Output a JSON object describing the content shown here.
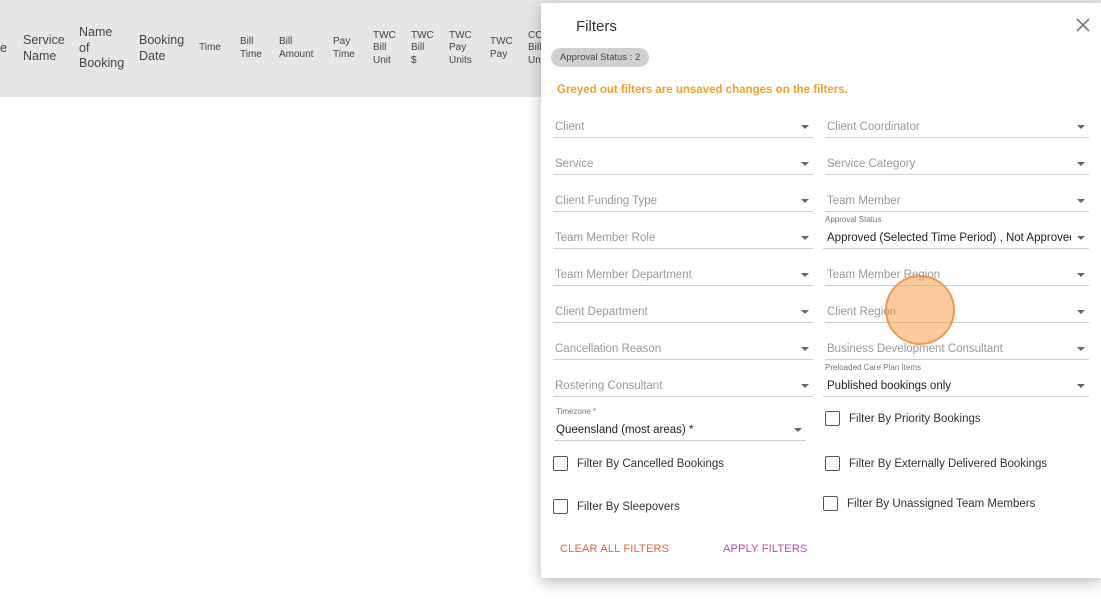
{
  "table_header": {
    "columns": [
      {
        "label": "e",
        "size": "lg"
      },
      {
        "label": "Service\nName",
        "size": "lg"
      },
      {
        "label": "Name\nof\nBooking",
        "size": "lg"
      },
      {
        "label": "Booking\nDate",
        "size": "lg"
      },
      {
        "label": "Time",
        "size": "sm"
      },
      {
        "label": "Bill\nTime",
        "size": "sm"
      },
      {
        "label": "Bill\nAmount",
        "size": "sm"
      },
      {
        "label": "Pay\nTime",
        "size": "sm"
      },
      {
        "label": "TWC\nBill\nUnit",
        "size": "sm"
      },
      {
        "label": "TWC\nBill\n$",
        "size": "sm"
      },
      {
        "label": "TWC\nPay\nUnits",
        "size": "sm"
      },
      {
        "label": "TWC\nPay",
        "size": "sm"
      },
      {
        "label": "CO\nBill\nUn",
        "size": "sm"
      }
    ]
  },
  "dialog": {
    "title": "Filters",
    "chip": "Approval Status : 2",
    "warning": "Greyed out filters are unsaved changes on the filters.",
    "selects": [
      {
        "name": "client-select",
        "value": "Client"
      },
      {
        "name": "client-coordinator-select",
        "value": "Client Coordinator"
      },
      {
        "name": "service-select",
        "value": "Service"
      },
      {
        "name": "service-category-select",
        "value": "Service Category"
      },
      {
        "name": "client-funding-type-select",
        "value": "Client Funding Type"
      },
      {
        "name": "team-member-select",
        "value": "Team Member"
      },
      {
        "name": "team-member-role-select",
        "value": "Team Member Role"
      },
      {
        "name": "approval-status-select",
        "label": "Approval Status",
        "value": "Approved (Selected Time Period) , Not Approved"
      },
      {
        "name": "team-member-department-select",
        "value": "Team Member Department"
      },
      {
        "name": "team-member-region-select",
        "value": "Team Member Region"
      },
      {
        "name": "client-department-select",
        "value": "Client Department"
      },
      {
        "name": "client-region-select",
        "value": "Client Region"
      },
      {
        "name": "cancellation-reason-select",
        "value": "Cancellation Reason"
      },
      {
        "name": "business-development-consultant-select",
        "value": "Business Development Consultant"
      },
      {
        "name": "rostering-consultant-select",
        "value": "Rostering Consultant"
      },
      {
        "name": "preloaded-care-plan-items-select",
        "label": "Preloaded Care Plan Items",
        "value": "Published bookings only"
      },
      {
        "name": "timezone-select",
        "label": "Timezone *",
        "value": "Queensland (most areas) *"
      }
    ],
    "checkboxes": [
      {
        "name": "filter-priority-bookings-checkbox",
        "label": "Filter By Priority Bookings"
      },
      {
        "name": "filter-cancelled-bookings-checkbox",
        "label": "Filter By Cancelled Bookings"
      },
      {
        "name": "filter-externally-delivered-checkbox",
        "label": "Filter By Externally Delivered Bookings"
      },
      {
        "name": "filter-sleepovers-checkbox",
        "label": "Filter By Sleepovers"
      },
      {
        "name": "filter-unassigned-team-members-checkbox",
        "label": "Filter By Unassigned Team Members"
      }
    ],
    "clear_label": "CLEAR ALL FILTERS",
    "apply_label": "APPLY FILTERS"
  },
  "colors": {
    "warning": "#f0a030",
    "clear_button": "#e06440",
    "apply_button": "#b04fb0",
    "header_bg": "#e6e6e6"
  }
}
